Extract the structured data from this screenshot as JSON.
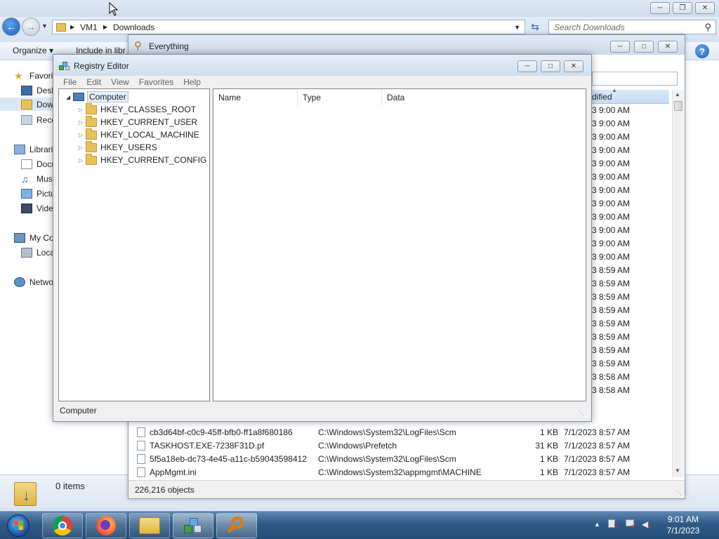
{
  "explorer": {
    "breadcrumb_root": "VM1",
    "breadcrumb_folder": "Downloads",
    "search_placeholder": "Search Downloads",
    "toolbar": {
      "organize": "Organize",
      "include_in_library": "Include in libr"
    },
    "nav": {
      "favorites": "Favorit",
      "desktop": "Desk",
      "downloads": "Dow",
      "recent": "Rece",
      "libraries": "Librari",
      "documents": "Docu",
      "music": "Mus",
      "pictures": "Pictu",
      "videos": "Vide",
      "computer": "My Co",
      "local_disk": "Loca",
      "network": "Netwo"
    },
    "details": {
      "items_count": "0 items"
    }
  },
  "everything": {
    "title": "Everything",
    "sort_header": "dified",
    "visible_dates": [
      "3 9:00 AM",
      "3 9:00 AM",
      "3 9:00 AM",
      "3 9:00 AM",
      "3 9:00 AM",
      "3 9:00 AM",
      "3 9:00 AM",
      "3 9:00 AM",
      "3 9:00 AM",
      "3 9:00 AM",
      "3 9:00 AM",
      "3 9:00 AM",
      "3 8:59 AM",
      "3 8:59 AM",
      "3 8:59 AM",
      "3 8:59 AM",
      "3 8:59 AM",
      "3 8:59 AM",
      "3 8:59 AM",
      "3 8:59 AM",
      "3 8:58 AM",
      "3 8:58 AM"
    ],
    "rows": [
      {
        "name": "cb3d64bf-c0c9-45ff-bfb0-ff1a8f680186",
        "path": "C:\\Windows\\System32\\LogFiles\\Scm",
        "size": "1 KB",
        "date": "7/1/2023 8:57 AM"
      },
      {
        "name": "TASKHOST.EXE-7238F31D.pf",
        "path": "C:\\Windows\\Prefetch",
        "size": "31 KB",
        "date": "7/1/2023 8:57 AM"
      },
      {
        "name": "5f5a18eb-dc73-4e45-a11c-b59043598412",
        "path": "C:\\Windows\\System32\\LogFiles\\Scm",
        "size": "1 KB",
        "date": "7/1/2023 8:57 AM"
      },
      {
        "name": "AppMgmt.ini",
        "path": "C:\\Windows\\System32\\appmgmt\\MACHINE",
        "size": "1 KB",
        "date": "7/1/2023 8:57 AM"
      }
    ],
    "status": "226,216 objects"
  },
  "registry": {
    "title": "Registry Editor",
    "menu": [
      "File",
      "Edit",
      "View",
      "Favorites",
      "Help"
    ],
    "tree": {
      "root": "Computer",
      "hives": [
        "HKEY_CLASSES_ROOT",
        "HKEY_CURRENT_USER",
        "HKEY_LOCAL_MACHINE",
        "HKEY_USERS",
        "HKEY_CURRENT_CONFIG"
      ]
    },
    "columns": [
      "Name",
      "Type",
      "Data"
    ],
    "status": "Computer"
  },
  "taskbar": {
    "apps": [
      "chrome-icon",
      "firefox-icon",
      "file-explorer-icon",
      "registry-editor-icon",
      "everything-search-icon"
    ],
    "clock_time": "9:01 AM",
    "clock_date": "7/1/2023"
  }
}
